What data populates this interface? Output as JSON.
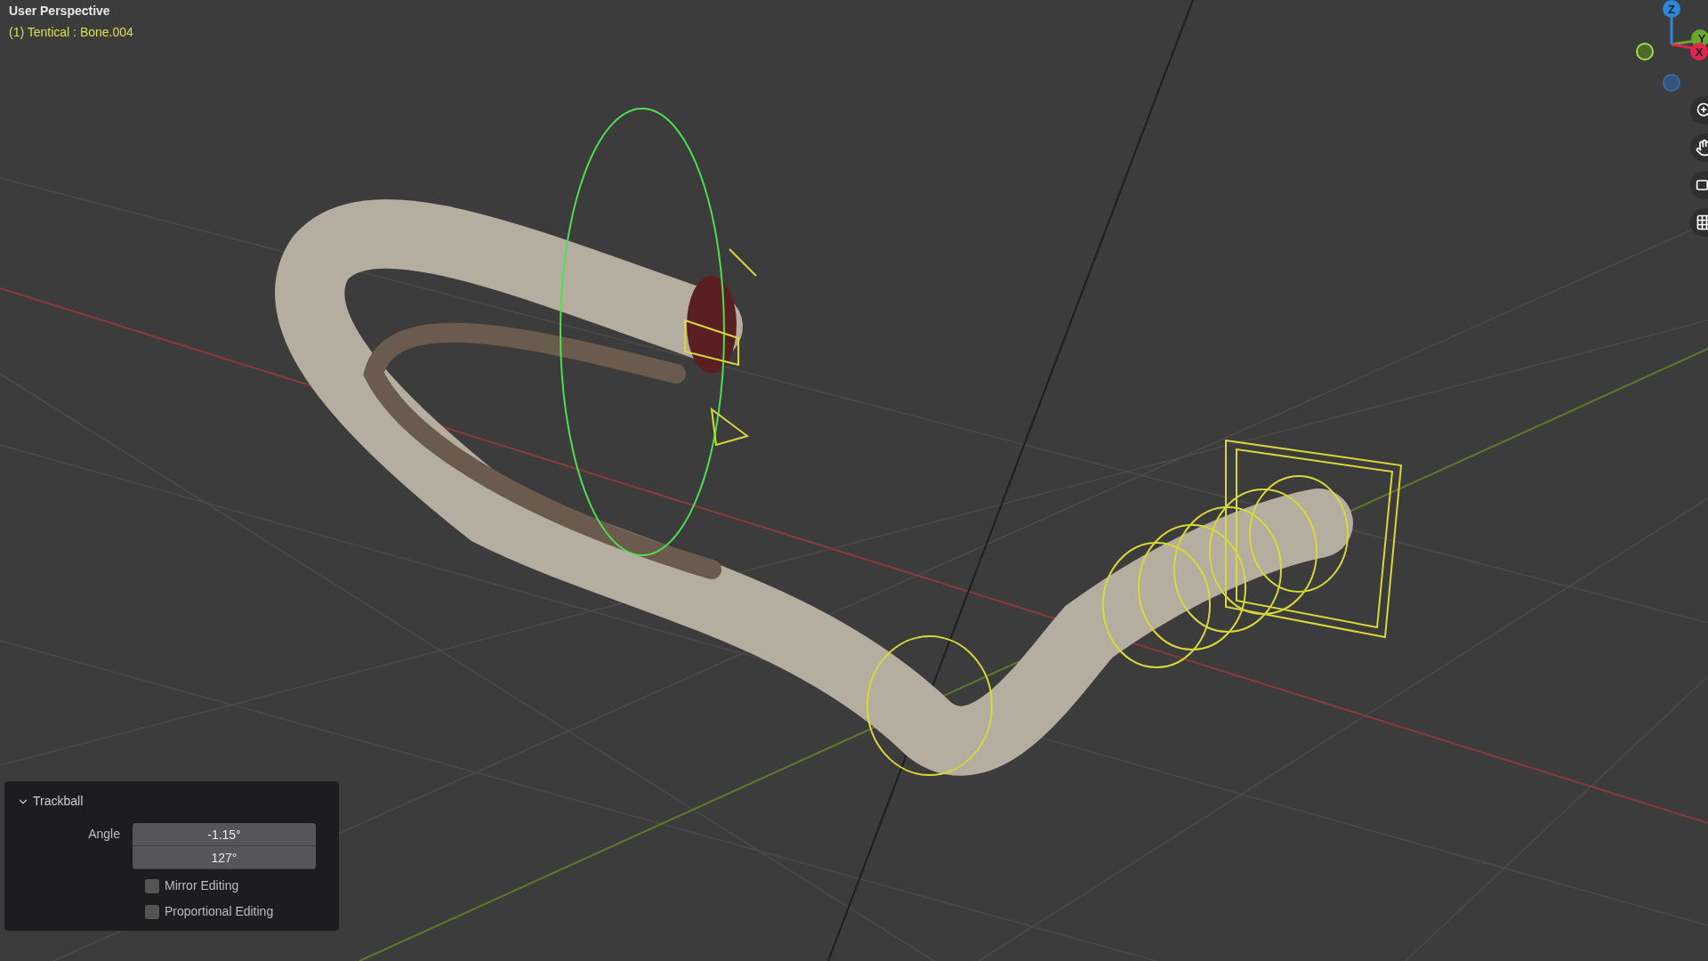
{
  "viewport": {
    "view_name": "User Perspective",
    "selection": "(1) Tentical : Bone.004"
  },
  "gizmo": {
    "axes": [
      {
        "label": "Z",
        "color": "#2f86d8"
      },
      {
        "label": "Y",
        "color": "#6aa82a"
      },
      {
        "label": "X",
        "color": "#e0264d"
      }
    ]
  },
  "operator_panel": {
    "title": "Trackball",
    "expanded": true,
    "angle_label": "Angle",
    "angle_values": [
      "-1.15°",
      "127°"
    ],
    "options": [
      {
        "label": "Mirror Editing",
        "checked": false
      },
      {
        "label": "Proportional Editing",
        "checked": false
      }
    ]
  }
}
